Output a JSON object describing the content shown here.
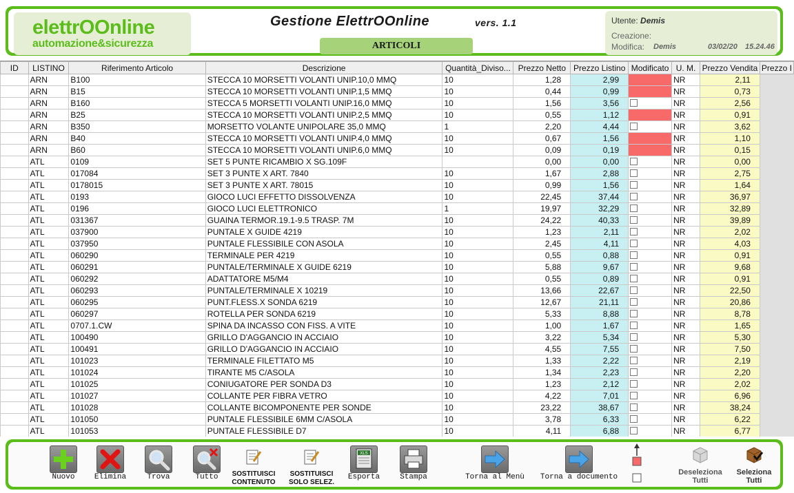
{
  "header": {
    "logo_line1": "elettrOOnline",
    "logo_line2": "automazione&sicurezza",
    "title": "Gestione  ElettrOOnline",
    "version": "vers. 1.1",
    "section": "ARTICOLI",
    "user_label": "Utente:",
    "user_name": "Demis",
    "creation_label": "Creazione:",
    "modified_label": "Modifica:",
    "modified_user": "Demis",
    "modified_date": "03/02/20",
    "modified_time": "15.24.46"
  },
  "columns": [
    "ID",
    "LISTINO",
    "Riferimento Articolo",
    "Descrizione",
    "Quantità_Diviso...",
    "Prezzo Netto",
    "Prezzo Listino",
    "Modificato",
    "U. M.",
    "Prezzo Vendita",
    "Prezzo I"
  ],
  "rows": [
    {
      "id": "",
      "listino": "ARN",
      "rif": "B100",
      "desc": "STECCA 10 MORSETTI VOLANTI UNIP.10,0 MMQ",
      "qta": "10",
      "netto": "1,28",
      "listino_p": "2,99",
      "mod": true,
      "um": "NR",
      "vendita": "2,11"
    },
    {
      "id": "",
      "listino": "ARN",
      "rif": "B15",
      "desc": "STECCA 10 MORSETTI VOLANTI UNIP.1,5 MMQ",
      "qta": "10",
      "netto": "0,44",
      "listino_p": "0,99",
      "mod": true,
      "um": "NR",
      "vendita": "0,73"
    },
    {
      "id": "",
      "listino": "ARN",
      "rif": "B160",
      "desc": "STECCA 5 MORSETTI VOLANTI UNIP.16,0 MMQ",
      "qta": "10",
      "netto": "1,56",
      "listino_p": "3,56",
      "mod": false,
      "um": "NR",
      "vendita": "2,56"
    },
    {
      "id": "",
      "listino": "ARN",
      "rif": "B25",
      "desc": "STECCA 10 MORSETTI VOLANTI UNIP.2,5 MMQ",
      "qta": "10",
      "netto": "0,55",
      "listino_p": "1,12",
      "mod": true,
      "um": "NR",
      "vendita": "0,91"
    },
    {
      "id": "",
      "listino": "ARN",
      "rif": "B350",
      "desc": "MORSETTO VOLANTE UNIPOLARE 35,0 MMQ",
      "qta": "1",
      "netto": "2,20",
      "listino_p": "4,44",
      "mod": false,
      "um": "NR",
      "vendita": "3,62"
    },
    {
      "id": "",
      "listino": "ARN",
      "rif": "B40",
      "desc": "STECCA 10 MORSETTI VOLANTI UNIP.4,0 MMQ",
      "qta": "10",
      "netto": "0,67",
      "listino_p": "1,56",
      "mod": true,
      "um": "NR",
      "vendita": "1,10"
    },
    {
      "id": "",
      "listino": "ARN",
      "rif": "B60",
      "desc": "STECCA 10 MORSETTI VOLANTI UNIP.6,0 MMQ",
      "qta": "10",
      "netto": "0,09",
      "listino_p": "0,19",
      "mod": true,
      "um": "NR",
      "vendita": "0,15"
    },
    {
      "id": "",
      "listino": "ATL",
      "rif": "0109",
      "desc": "SET 5 PUNTE RICAMBIO X SG.109F",
      "qta": "",
      "netto": "0,00",
      "listino_p": "0,00",
      "mod": false,
      "um": "NR",
      "vendita": "0,00"
    },
    {
      "id": "",
      "listino": "ATL",
      "rif": "017084",
      "desc": "SET 3 PUNTE X ART. 7840",
      "qta": "10",
      "netto": "1,67",
      "listino_p": "2,88",
      "mod": false,
      "um": "NR",
      "vendita": "2,75"
    },
    {
      "id": "",
      "listino": "ATL",
      "rif": "0178015",
      "desc": "SET 3 PUNTE X ART. 78015",
      "qta": "10",
      "netto": "0,99",
      "listino_p": "1,56",
      "mod": false,
      "um": "NR",
      "vendita": "1,64"
    },
    {
      "id": "",
      "listino": "ATL",
      "rif": "0193",
      "desc": "GIOCO LUCI EFFETTO DISSOLVENZA",
      "qta": "10",
      "netto": "22,45",
      "listino_p": "37,44",
      "mod": false,
      "um": "NR",
      "vendita": "36,97"
    },
    {
      "id": "",
      "listino": "ATL",
      "rif": "0196",
      "desc": "GIOCO LUCI ELETTRONICO",
      "qta": "1",
      "netto": "19,97",
      "listino_p": "32,29",
      "mod": false,
      "um": "NR",
      "vendita": "32,89"
    },
    {
      "id": "",
      "listino": "ATL",
      "rif": "031367",
      "desc": "GUAINA TERMOR.19.1-9.5 TRASP. 7M",
      "qta": "10",
      "netto": "24,22",
      "listino_p": "40,33",
      "mod": false,
      "um": "NR",
      "vendita": "39,89"
    },
    {
      "id": "",
      "listino": "ATL",
      "rif": "037900",
      "desc": "PUNTALE X GUIDE 4219",
      "qta": "10",
      "netto": "1,23",
      "listino_p": "2,11",
      "mod": false,
      "um": "NR",
      "vendita": "2,02"
    },
    {
      "id": "",
      "listino": "ATL",
      "rif": "037950",
      "desc": "PUNTALE FLESSIBILE CON ASOLA",
      "qta": "10",
      "netto": "2,45",
      "listino_p": "4,11",
      "mod": false,
      "um": "NR",
      "vendita": "4,03"
    },
    {
      "id": "",
      "listino": "ATL",
      "rif": "060290",
      "desc": "TERMINALE PER 4219",
      "qta": "10",
      "netto": "0,55",
      "listino_p": "0,88",
      "mod": false,
      "um": "NR",
      "vendita": "0,91"
    },
    {
      "id": "",
      "listino": "ATL",
      "rif": "060291",
      "desc": "PUNTALE/TERMINALE X GUIDE 6219",
      "qta": "10",
      "netto": "5,88",
      "listino_p": "9,67",
      "mod": false,
      "um": "NR",
      "vendita": "9,68"
    },
    {
      "id": "",
      "listino": "ATL",
      "rif": "060292",
      "desc": "ADATTATORE M5/M4",
      "qta": "10",
      "netto": "0,55",
      "listino_p": "0,89",
      "mod": false,
      "um": "NR",
      "vendita": "0,91"
    },
    {
      "id": "",
      "listino": "ATL",
      "rif": "060293",
      "desc": "PUNTALE/TERMINALE X 10219",
      "qta": "10",
      "netto": "13,66",
      "listino_p": "22,67",
      "mod": false,
      "um": "NR",
      "vendita": "22,50"
    },
    {
      "id": "",
      "listino": "ATL",
      "rif": "060295",
      "desc": "PUNT.FLESS.X SONDA 6219",
      "qta": "10",
      "netto": "12,67",
      "listino_p": "21,11",
      "mod": false,
      "um": "NR",
      "vendita": "20,86"
    },
    {
      "id": "",
      "listino": "ATL",
      "rif": "060297",
      "desc": "ROTELLA PER SONDA 6219",
      "qta": "10",
      "netto": "5,33",
      "listino_p": "8,88",
      "mod": false,
      "um": "NR",
      "vendita": "8,78"
    },
    {
      "id": "",
      "listino": "ATL",
      "rif": "0707.1.CW",
      "desc": "SPINA DA INCASSO CON FISS. A VITE",
      "qta": "10",
      "netto": "1,00",
      "listino_p": "1,67",
      "mod": false,
      "um": "NR",
      "vendita": "1,65"
    },
    {
      "id": "",
      "listino": "ATL",
      "rif": "100490",
      "desc": "GRILLO D'AGGANCIO IN ACCIAIO",
      "qta": "10",
      "netto": "3,22",
      "listino_p": "5,34",
      "mod": false,
      "um": "NR",
      "vendita": "5,30"
    },
    {
      "id": "",
      "listino": "ATL",
      "rif": "100491",
      "desc": "GRILLO D'AGGANCIO IN ACCIAIO",
      "qta": "10",
      "netto": "4,55",
      "listino_p": "7,55",
      "mod": false,
      "um": "NR",
      "vendita": "7,50"
    },
    {
      "id": "",
      "listino": "ATL",
      "rif": "101023",
      "desc": "TERMINALE FILETTATO M5",
      "qta": "10",
      "netto": "1,33",
      "listino_p": "2,22",
      "mod": false,
      "um": "NR",
      "vendita": "2,19"
    },
    {
      "id": "",
      "listino": "ATL",
      "rif": "101024",
      "desc": "TIRANTE M5 C/ASOLA",
      "qta": "10",
      "netto": "1,34",
      "listino_p": "2,23",
      "mod": false,
      "um": "NR",
      "vendita": "2,20"
    },
    {
      "id": "",
      "listino": "ATL",
      "rif": "101025",
      "desc": "CONIUGATORE PER SONDA D3",
      "qta": "10",
      "netto": "1,23",
      "listino_p": "2,12",
      "mod": false,
      "um": "NR",
      "vendita": "2,02"
    },
    {
      "id": "",
      "listino": "ATL",
      "rif": "101027",
      "desc": "COLLANTE PER FIBRA VETRO",
      "qta": "10",
      "netto": "4,22",
      "listino_p": "7,01",
      "mod": false,
      "um": "NR",
      "vendita": "6,96"
    },
    {
      "id": "",
      "listino": "ATL",
      "rif": "101028",
      "desc": "COLLANTE BICOMPONENTE PER SONDE",
      "qta": "10",
      "netto": "23,22",
      "listino_p": "38,67",
      "mod": false,
      "um": "NR",
      "vendita": "38,24"
    },
    {
      "id": "",
      "listino": "ATL",
      "rif": "101050",
      "desc": "PUNTALE FLESSIBILE 6MM C/ASOLA",
      "qta": "10",
      "netto": "3,78",
      "listino_p": "6,33",
      "mod": false,
      "um": "NR",
      "vendita": "6,22"
    },
    {
      "id": "",
      "listino": "ATL",
      "rif": "101053",
      "desc": "PUNTALE FLESSIBILE D7",
      "qta": "10",
      "netto": "4,11",
      "listino_p": "6,88",
      "mod": false,
      "um": "NR",
      "vendita": "6,77"
    }
  ],
  "toolbar": {
    "nuovo": "Nuovo",
    "elimina": "Elimina",
    "trova": "Trova",
    "tutto": "Tutto",
    "sost_contenuto_1": "SOSTITUISCI",
    "sost_contenuto_2": "CONTENUTO",
    "sost_selez_1": "SOSTITUISCI",
    "sost_selez_2": "SOLO SELEZ.",
    "esporta": "Esporta",
    "esporta_badge": "XLS",
    "stampa": "Stampa",
    "torna_menu": "Torna al Menù",
    "torna_documento": "Torna a documento",
    "deseleziona_1": "Deseleziona",
    "deseleziona_2": "Tutti",
    "seleziona_1": "Seleziona",
    "seleziona_2": "Tutti"
  },
  "colors": {
    "brand_green": "#5bbd1a",
    "listino_bg": "#c8f0f3",
    "vendita_bg": "#fafac4",
    "modified_red": "#f86a6a"
  }
}
